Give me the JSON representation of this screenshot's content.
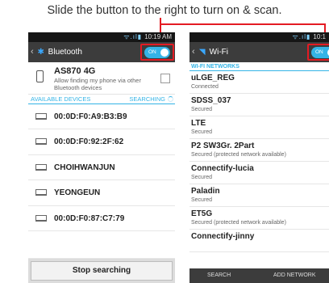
{
  "caption": "Slide the button to the right to turn on & scan.",
  "bluetooth_screen": {
    "status_icons": "ᯤ.ıl▮",
    "time": "10:19 AM",
    "title": "Bluetooth",
    "toggle_label": "ON",
    "my_device": {
      "name": "AS870 4G",
      "subtitle": "Allow finding my phone via other Bluetooth devices"
    },
    "section_label": "AVAILABLE DEVICES",
    "section_status": "SEARCHING",
    "devices": [
      "00:0D:F0:A9:B3:B9",
      "00:0D:F0:92:2F:62",
      "CHOIHWANJUN",
      "YEONGEUN",
      "00:0D:F0:87:C7:79"
    ],
    "stop_button": "Stop searching"
  },
  "wifi_screen": {
    "status_icons": "ᯤ.ıl▮",
    "time": "10:1",
    "title": "Wi-Fi",
    "toggle_label": "ON",
    "section_label": "WI-FI NETWORKS",
    "networks": [
      {
        "name": "uLGE_REG",
        "status": "Connected"
      },
      {
        "name": "SDSS_037",
        "status": "Secured"
      },
      {
        "name": "LTE",
        "status": "Secured"
      },
      {
        "name": "P2 SW3Gr. 2Part",
        "status": "Secured (protected network available)"
      },
      {
        "name": "Connectify-lucia",
        "status": "Secured"
      },
      {
        "name": "Paladin",
        "status": "Secured"
      },
      {
        "name": "ET5G",
        "status": "Secured (protected network available)"
      },
      {
        "name": "Connectify-jinny",
        "status": ""
      }
    ],
    "search_button": "SEARCH",
    "add_button": "ADD NETWORK"
  },
  "colors": {
    "accent": "#34b4e6",
    "callout": "#e41b23",
    "actionbar": "#3c3c3c"
  }
}
